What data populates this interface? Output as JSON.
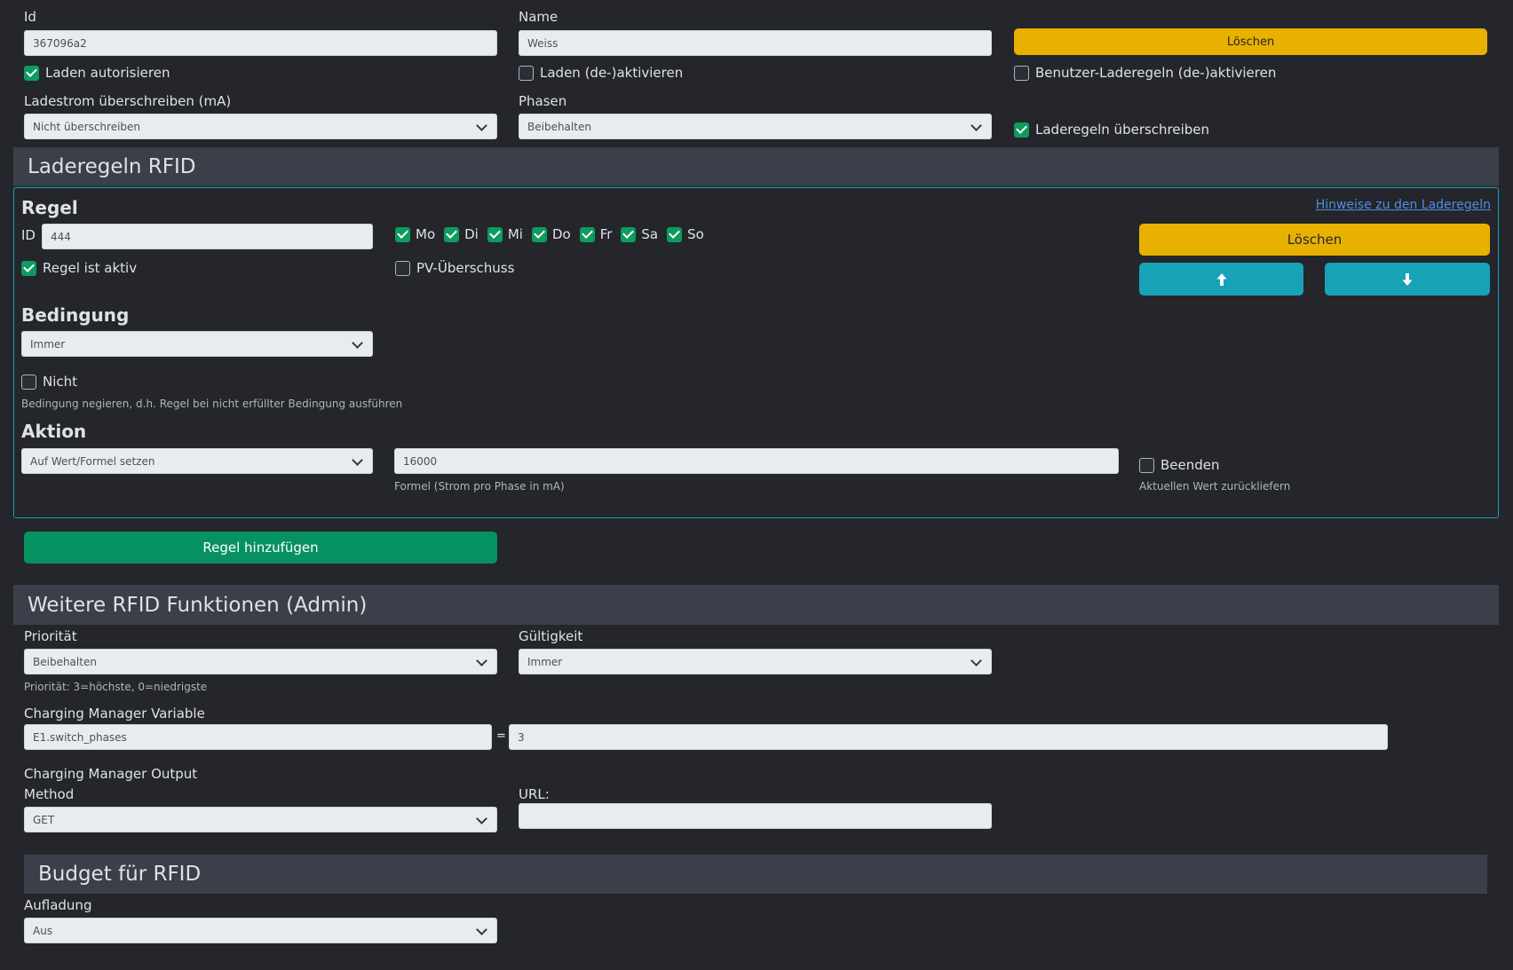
{
  "top": {
    "id_label": "Id",
    "id_value": "367096a2",
    "name_label": "Name",
    "name_value": "Weiss",
    "delete_label": "Löschen",
    "authorize_label": "Laden autorisieren",
    "authorize_checked": true,
    "enable_label": "Laden (de-)aktivieren",
    "enable_checked": false,
    "user_rules_label": "Benutzer-Laderegeln (de-)aktivieren",
    "user_rules_checked": false,
    "current_label": "Ladestrom überschreiben (mA)",
    "current_value": "Nicht überschreiben",
    "phases_label": "Phasen",
    "phases_value": "Beibehalten",
    "override_rules_label": "Laderegeln überschreiben",
    "override_rules_checked": true
  },
  "rules_section": {
    "title": "Laderegeln RFID",
    "rule_heading": "Regel",
    "hints_link": "Hinweise zu den Laderegeln",
    "id_label": "ID",
    "id_value": "444",
    "days": [
      {
        "label": "Mo",
        "checked": true
      },
      {
        "label": "Di",
        "checked": true
      },
      {
        "label": "Mi",
        "checked": true
      },
      {
        "label": "Do",
        "checked": true
      },
      {
        "label": "Fr",
        "checked": true
      },
      {
        "label": "Sa",
        "checked": true
      },
      {
        "label": "So",
        "checked": true
      }
    ],
    "active_label": "Regel ist aktiv",
    "active_checked": true,
    "pv_label": "PV-Überschuss",
    "pv_checked": false,
    "delete_label": "Löschen",
    "up_icon": "arrow-up-icon",
    "down_icon": "arrow-down-icon",
    "condition_heading": "Bedingung",
    "condition_value": "Immer",
    "not_label": "Nicht",
    "not_checked": false,
    "not_hint": "Bedingung negieren, d.h. Regel bei nicht erfüllter Bedingung ausführen",
    "action_heading": "Aktion",
    "action_value": "Auf Wert/Formel setzen",
    "formula_value": "16000",
    "formula_hint": "Formel (Strom pro Phase in mA)",
    "end_label": "Beenden",
    "end_checked": false,
    "end_hint": "Aktuellen Wert zurückliefern",
    "add_rule_label": "Regel hinzufügen"
  },
  "admin_section": {
    "title": "Weitere RFID Funktionen (Admin)",
    "priority_label": "Priorität",
    "priority_value": "Beibehalten",
    "priority_hint": "Priorität: 3=höchste, 0=niedrigste",
    "validity_label": "Gültigkeit",
    "validity_value": "Immer",
    "cm_var_label": "Charging Manager Variable",
    "cm_var_name": "E1.switch_phases",
    "cm_var_eq": "=",
    "cm_var_value": "3",
    "cm_output_label": "Charging Manager Output",
    "method_label": "Method",
    "method_value": "GET",
    "url_label": "URL:",
    "url_value": ""
  },
  "budget_section": {
    "title": "Budget für RFID",
    "charging_label": "Aufladung",
    "charging_value": "Aus"
  },
  "colors": {
    "background": "#24262b",
    "section_bar": "#3a3f4a",
    "yellow": "#e8b100",
    "teal": "#17a2b8",
    "green": "#069160",
    "rule_border": "#17a2b8"
  }
}
